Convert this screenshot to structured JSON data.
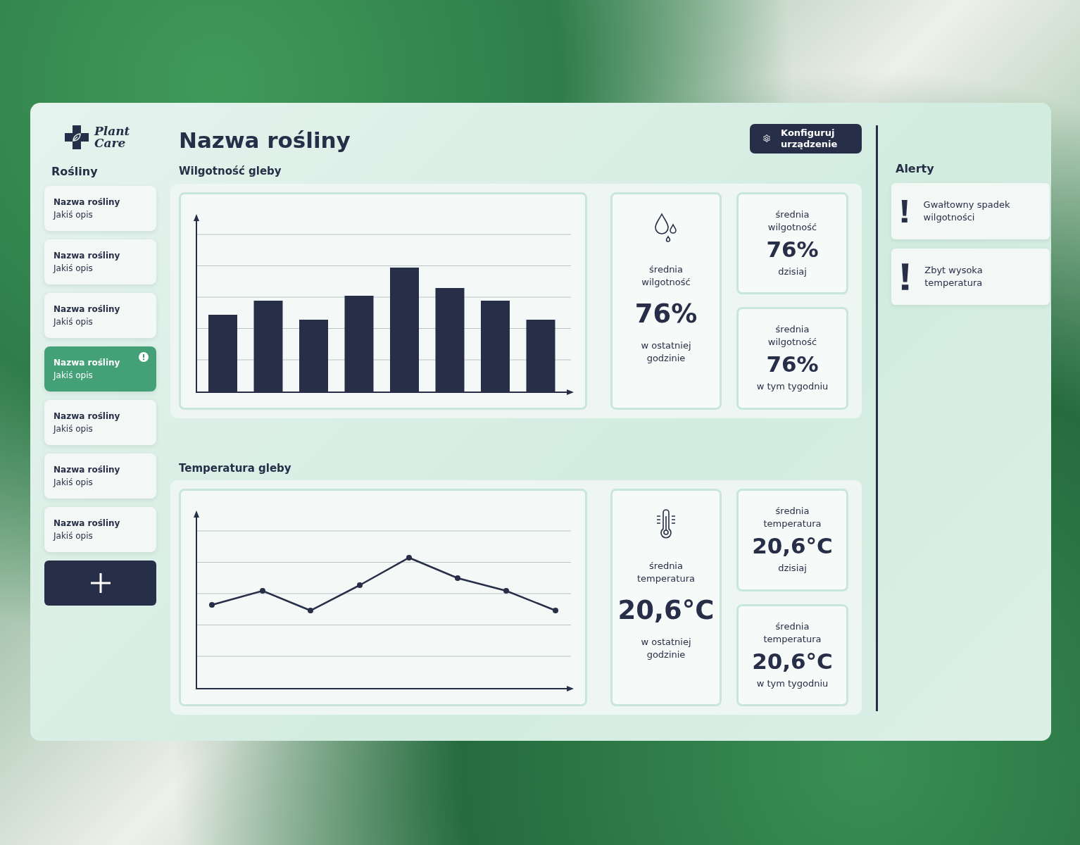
{
  "logo": {
    "text": "Plant Care"
  },
  "sidebar": {
    "title": "Rośliny",
    "items": [
      {
        "name": "Nazwa rośliny",
        "description": "Jakiś opis",
        "selected": false,
        "alert": false
      },
      {
        "name": "Nazwa rośliny",
        "description": "Jakiś opis",
        "selected": false,
        "alert": false
      },
      {
        "name": "Nazwa rośliny",
        "description": "Jakiś opis",
        "selected": false,
        "alert": false
      },
      {
        "name": "Nazwa rośliny",
        "description": "Jakiś opis",
        "selected": true,
        "alert": true
      },
      {
        "name": "Nazwa rośliny",
        "description": "Jakiś opis",
        "selected": false,
        "alert": false
      },
      {
        "name": "Nazwa rośliny",
        "description": "Jakiś opis",
        "selected": false,
        "alert": false
      },
      {
        "name": "Nazwa rośliny",
        "description": "Jakiś opis",
        "selected": false,
        "alert": false
      }
    ]
  },
  "header": {
    "title": "Nazwa rośliny",
    "button": "Konfiguruj urządzenie"
  },
  "sections": [
    {
      "title": "Wilgotność gleby",
      "kind": "humidity",
      "stats": [
        {
          "label": "średnia wilgotność",
          "value": "76%",
          "period": "w ostatniej godzinie"
        },
        {
          "label": "średnia wilgotność",
          "value": "76%",
          "period": "dzisiaj"
        },
        {
          "label": "średnia wilgotność",
          "value": "76%",
          "period": "w tym tygodniu"
        }
      ]
    },
    {
      "title": "Temperatura gleby",
      "kind": "temperature",
      "stats": [
        {
          "label": "średnia temperatura",
          "value": "20,6°C",
          "period": "w ostatniej godzinie"
        },
        {
          "label": "średnia temperatura",
          "value": "20,6°C",
          "period": "dzisiaj"
        },
        {
          "label": "średnia temperatura",
          "value": "20,6°C",
          "period": "w tym tygodniu"
        }
      ]
    }
  ],
  "alerts": {
    "title": "Alerty",
    "items": [
      {
        "text": "Gwałtowny spadek wilgotności"
      },
      {
        "text": "Zbyt wysoka temperatura"
      }
    ]
  }
}
